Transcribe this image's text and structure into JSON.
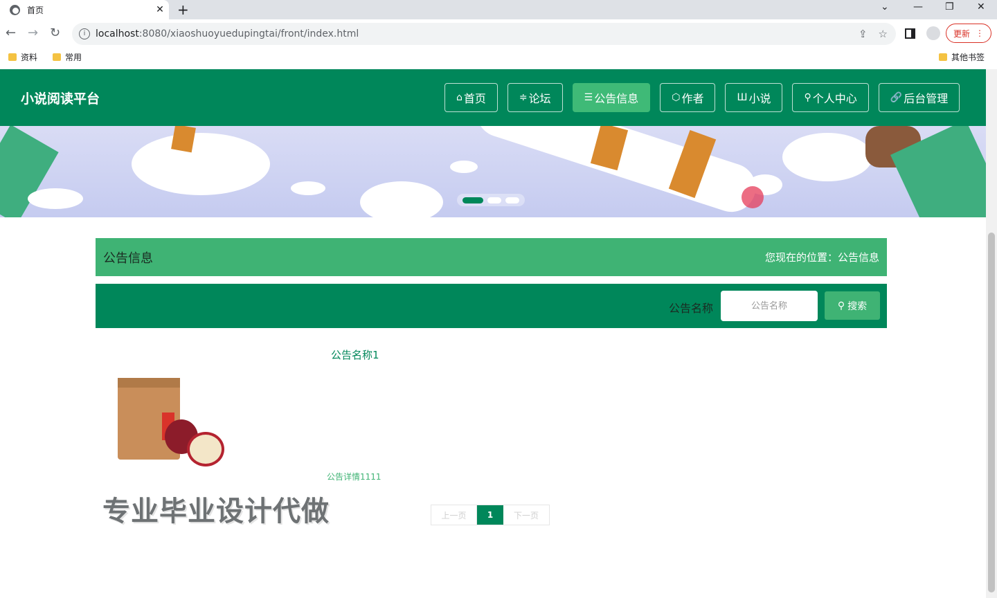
{
  "browser": {
    "tab_title": "首页",
    "url_host": "localhost",
    "url_rest": ":8080/xiaoshuoyuedupingtai/front/index.html",
    "update_label": "更新",
    "bookmarks": [
      "资料",
      "常用"
    ],
    "other_bookmarks": "其他书签"
  },
  "header": {
    "brand": "小说阅读平台",
    "nav": [
      {
        "icon": "⌂",
        "label": "首页"
      },
      {
        "icon": "≑",
        "label": "论坛"
      },
      {
        "icon": "☰",
        "label": "公告信息"
      },
      {
        "icon": "⬡",
        "label": "作者"
      },
      {
        "icon": "Ш",
        "label": "小说"
      },
      {
        "icon": "⚲",
        "label": "个人中心"
      },
      {
        "icon": "🔗",
        "label": "后台管理"
      }
    ]
  },
  "crumb": {
    "title": "公告信息",
    "location": "您现在的位置：公告信息"
  },
  "search": {
    "label": "公告名称",
    "placeholder": "公告名称",
    "button": "搜索"
  },
  "cards": [
    {
      "title": "公告名称1",
      "desc": "公告详情1111"
    }
  ],
  "watermark": "专业毕业设计代做",
  "pager": {
    "prev": "上一页",
    "current": "1",
    "next": "下一页"
  },
  "colors": {
    "primary": "#00875a",
    "accent": "#3fb374"
  }
}
